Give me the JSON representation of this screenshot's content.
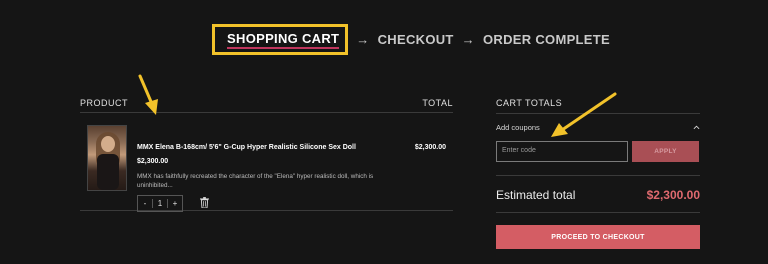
{
  "steps": {
    "cart": "SHOPPING CART",
    "checkout": "CHECKOUT",
    "complete": "ORDER COMPLETE",
    "arrow": "→"
  },
  "table": {
    "product_header": "PRODUCT",
    "total_header": "TOTAL"
  },
  "item": {
    "name": "MMX Elena B-168cm/ 5'6\" G-Cup Hyper Realistic Silicone Sex Doll",
    "price": "$2,300.00",
    "description": "MMX has faithfully recreated the character of the \"Elena\" hyper realistic doll, which is uninhibited...",
    "qty_minus": "-",
    "qty_value": "1",
    "qty_plus": "+",
    "line_total": "$2,300.00"
  },
  "totals": {
    "title": "CART TOTALS",
    "coupon_label": "Add coupons",
    "coupon_placeholder": "Enter code",
    "apply_label": "APPLY",
    "estimated_label": "Estimated total",
    "estimated_value": "$2,300.00",
    "checkout_label": "PROCEED TO CHECKOUT"
  },
  "colors": {
    "background": "#151515",
    "highlight": "#f2c22a",
    "accent": "#d45d64",
    "apply_bg": "#a94f55"
  },
  "icons": {
    "trash": "trash-icon",
    "chevron": "chevron-up-icon",
    "annotation": "annotation-arrow-icon"
  }
}
